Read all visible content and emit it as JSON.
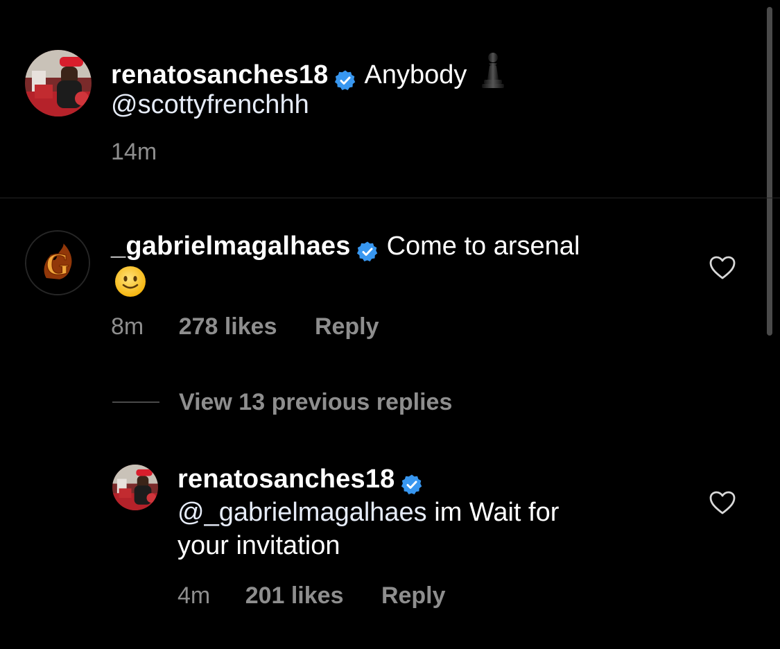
{
  "colors": {
    "background": "#000000",
    "text": "#ffffff",
    "meta": "#8e8e8e",
    "verified_badge": "#3897f0",
    "divider": "#262626"
  },
  "comments": [
    {
      "username": "renatosanches18",
      "verified": true,
      "text_line1": "Anybody",
      "emoji_after_text": "chess-pawn",
      "text_line2": "@scottyfrenchhh",
      "time": "14m"
    },
    {
      "username": "_gabrielmagalhaes",
      "verified": true,
      "text_line1": "Come to arsenal",
      "emoji_line2": "slightly-smiling-face",
      "time": "8m",
      "likes": "278 likes",
      "reply_label": "Reply"
    }
  ],
  "view_replies_label": "View 13 previous replies",
  "reply": {
    "username": "renatosanches18",
    "verified": true,
    "mention": "@_gabrielmagalhaes",
    "text_line2_rest": " im Wait for",
    "text_line3": "your invitation",
    "time": "4m",
    "likes": "201 likes",
    "reply_label": "Reply"
  }
}
